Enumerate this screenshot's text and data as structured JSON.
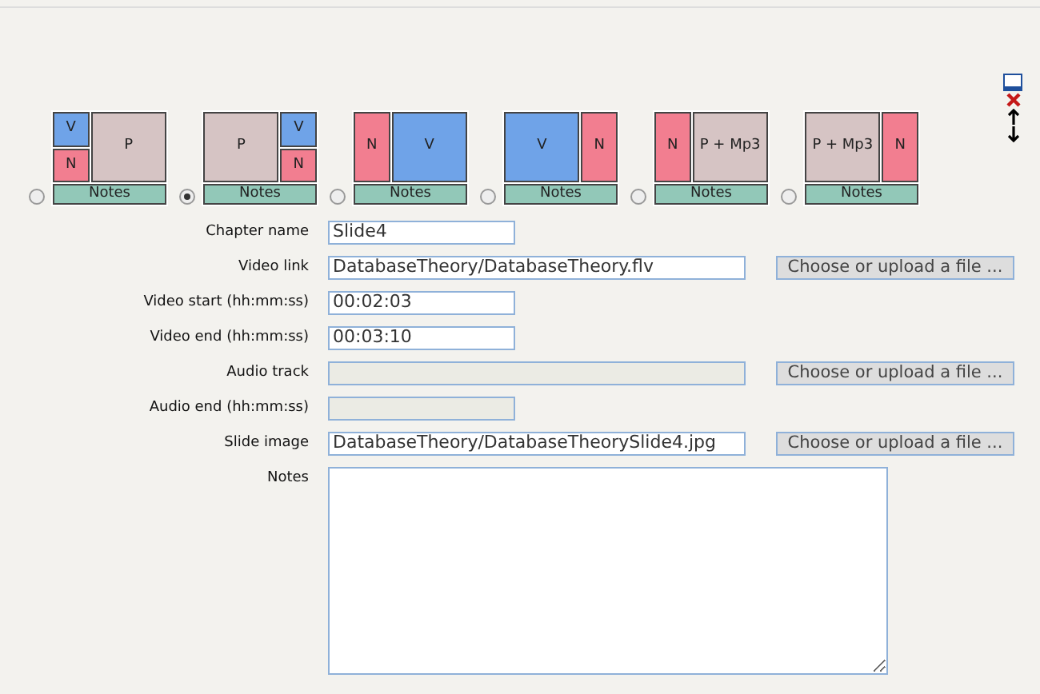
{
  "layouts": [
    {
      "selected": false,
      "notes": "Notes",
      "columns": [
        {
          "kind": "narrow",
          "cells": [
            {
              "kind": "video",
              "label": "V"
            },
            {
              "kind": "notes",
              "label": "N"
            }
          ]
        },
        {
          "kind": "wide",
          "cells": [
            {
              "kind": "presentation",
              "label": "P"
            }
          ]
        }
      ]
    },
    {
      "selected": true,
      "notes": "Notes",
      "columns": [
        {
          "kind": "wide",
          "cells": [
            {
              "kind": "presentation",
              "label": "P"
            }
          ]
        },
        {
          "kind": "narrow",
          "cells": [
            {
              "kind": "video",
              "label": "V"
            },
            {
              "kind": "notes",
              "label": "N"
            }
          ]
        }
      ]
    },
    {
      "selected": false,
      "notes": "Notes",
      "columns": [
        {
          "kind": "narrow",
          "cells": [
            {
              "kind": "notes",
              "label": "N"
            }
          ]
        },
        {
          "kind": "wide",
          "cells": [
            {
              "kind": "video",
              "label": "V"
            }
          ]
        }
      ]
    },
    {
      "selected": false,
      "notes": "Notes",
      "columns": [
        {
          "kind": "wide",
          "cells": [
            {
              "kind": "video",
              "label": "V"
            }
          ]
        },
        {
          "kind": "narrow",
          "cells": [
            {
              "kind": "notes",
              "label": "N"
            }
          ]
        }
      ]
    },
    {
      "selected": false,
      "notes": "Notes",
      "columns": [
        {
          "kind": "narrow",
          "cells": [
            {
              "kind": "notes",
              "label": "N"
            }
          ]
        },
        {
          "kind": "wide",
          "cells": [
            {
              "kind": "presentation",
              "label": "P + Mp3"
            }
          ]
        }
      ]
    },
    {
      "selected": false,
      "notes": "Notes",
      "columns": [
        {
          "kind": "wide",
          "cells": [
            {
              "kind": "presentation",
              "label": "P + Mp3"
            }
          ]
        },
        {
          "kind": "narrow",
          "cells": [
            {
              "kind": "notes",
              "label": "N"
            }
          ]
        }
      ]
    }
  ],
  "fields": [
    {
      "kind": "short",
      "label": "Chapter name",
      "value": "Slide4",
      "disabled": false
    },
    {
      "kind": "file",
      "label": "Video link",
      "value": "DatabaseTheory/DatabaseTheory.flv",
      "disabled": false,
      "button": "Choose or upload a file ..."
    },
    {
      "kind": "short",
      "label": "Video start (hh:mm:ss)",
      "value": "00:02:03",
      "disabled": false
    },
    {
      "kind": "short",
      "label": "Video end (hh:mm:ss)",
      "value": "00:03:10",
      "disabled": false
    },
    {
      "kind": "file",
      "label": "Audio track",
      "disabled": true,
      "button": "Choose or upload a file ..."
    },
    {
      "kind": "short",
      "label": "Audio end (hh:mm:ss)",
      "disabled": true
    },
    {
      "kind": "file",
      "label": "Slide image",
      "value": "DatabaseTheory/DatabaseTheorySlide4.jpg",
      "disabled": false,
      "button": "Choose or upload a file ..."
    },
    {
      "kind": "textarea",
      "label": "Notes",
      "disabled": false
    }
  ]
}
